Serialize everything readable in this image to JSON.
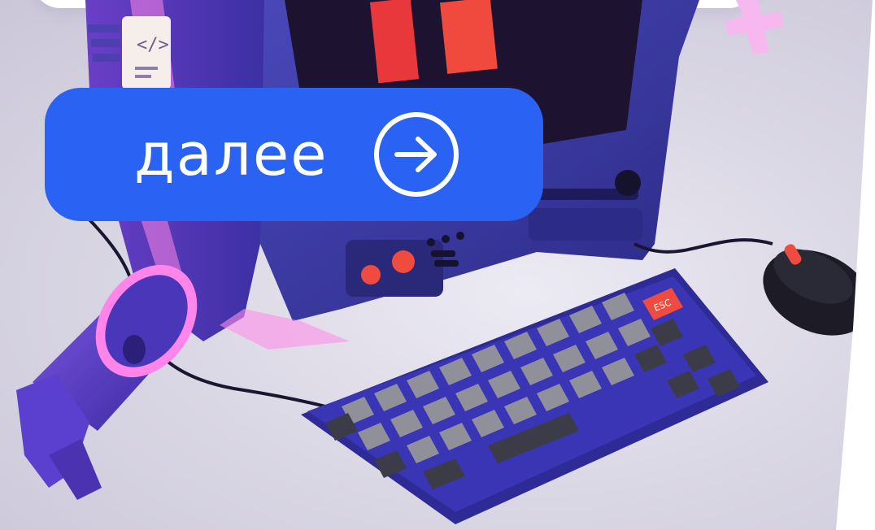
{
  "next_button": {
    "label": "далее",
    "icon": "arrow-right-icon"
  },
  "artwork": {
    "monitor_screen_tag": "</>",
    "escape_key_label": "ESC"
  },
  "colors": {
    "button": "#2a62f3",
    "button_text": "#ffffff",
    "device_body": "#3a3b9c",
    "accent_red": "#f0483c",
    "neon_pink": "#ff7ce6"
  }
}
